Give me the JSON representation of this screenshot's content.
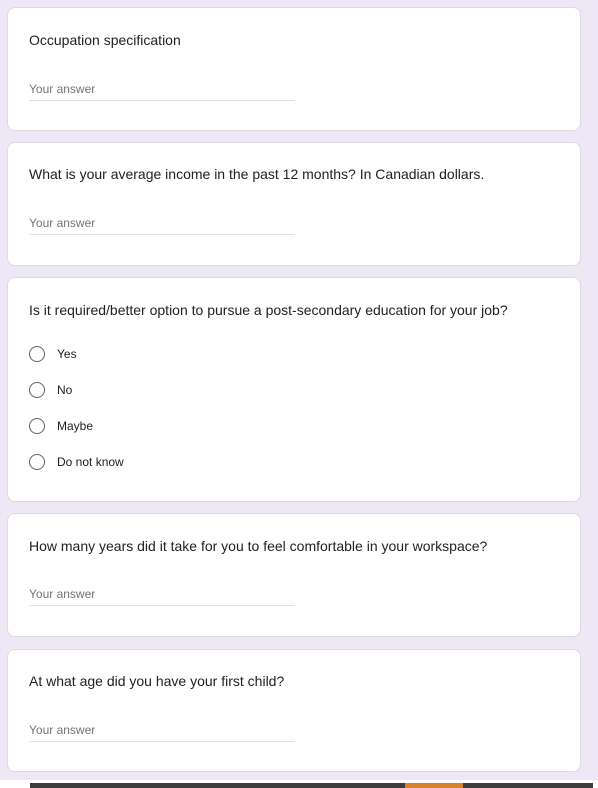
{
  "questions": {
    "occupation": {
      "title": "Occupation specification",
      "placeholder": "Your answer"
    },
    "income": {
      "title": "What is your average income in the past 12 months? In Canadian dollars.",
      "placeholder": "Your answer"
    },
    "education": {
      "title": "Is it required/better option to pursue a post-secondary education for your job?",
      "options": [
        "Yes",
        "No",
        "Maybe",
        "Do not know"
      ]
    },
    "comfort_years": {
      "title": "How many years did it take for you to feel comfortable in your workspace?",
      "placeholder": "Your answer"
    },
    "first_child_age": {
      "title": "At what age did you have your first child?",
      "placeholder": "Your answer"
    }
  },
  "colors": {
    "background": "#ede7f6",
    "card": "#ffffff",
    "card_border": "#dadce0",
    "text": "#202124",
    "placeholder": "#70757a"
  }
}
